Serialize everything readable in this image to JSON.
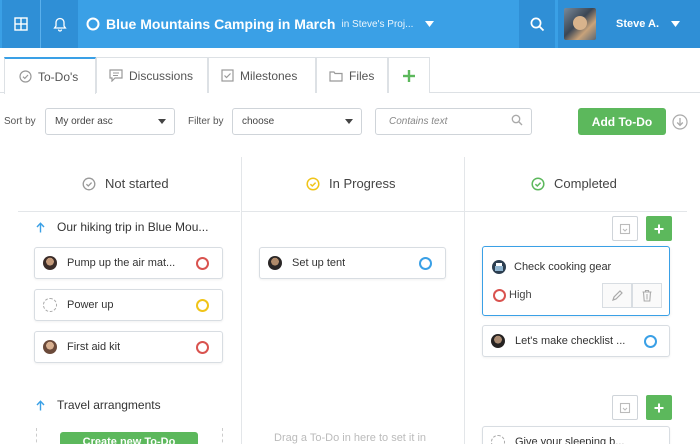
{
  "header": {
    "project_title": "Blue Mountains Camping in March",
    "project_context": "in Steve's Proj...",
    "user_name": "Steve A."
  },
  "tabs": [
    {
      "label": "To-Do's",
      "icon": "check-circle-icon",
      "active": true
    },
    {
      "label": "Discussions",
      "icon": "chat-icon"
    },
    {
      "label": "Milestones",
      "icon": "checkbox-icon"
    },
    {
      "label": "Files",
      "icon": "folder-icon"
    },
    {
      "label": "+",
      "icon": "plus-icon"
    }
  ],
  "filters": {
    "sort_label": "Sort by",
    "sort_value": "My order asc",
    "filter_label": "Filter by",
    "filter_value": "choose",
    "search_placeholder": "Contains text",
    "add_button": "Add To-Do"
  },
  "columns": [
    {
      "title": "Not started",
      "icon": "check-circle-icon",
      "icon_color": "#999999"
    },
    {
      "title": "In Progress",
      "icon": "check-circle-icon",
      "icon_color": "#f0c419"
    },
    {
      "title": "Completed",
      "icon": "check-circle-icon",
      "icon_color": "#5cb85c"
    }
  ],
  "groups": [
    {
      "title": "Our hiking trip in Blue Mou..."
    },
    {
      "title": "Travel arrangments"
    }
  ],
  "cards": {
    "not_started": [
      {
        "text": "Pump up the air mat...",
        "status": "red"
      },
      {
        "text": "Power up",
        "status": "yellow"
      },
      {
        "text": "First aid kit",
        "status": "red"
      }
    ],
    "in_progress": [
      {
        "text": "Set up tent",
        "status": "blue"
      }
    ],
    "completed": [
      {
        "text": "Check cooking gear",
        "priority": "High",
        "status": "red"
      },
      {
        "text": "Let's make checklist ...",
        "status": "blue"
      },
      {
        "text": "Give your sleeping b..."
      }
    ]
  },
  "drop_hint": "Drag a To-Do in here to set it in",
  "bottom_button": "Create new To-Do",
  "colors": {
    "brand_blue": "#3aa0e6",
    "green": "#5cb85c",
    "red": "#d9534f",
    "yellow": "#f0c419"
  }
}
